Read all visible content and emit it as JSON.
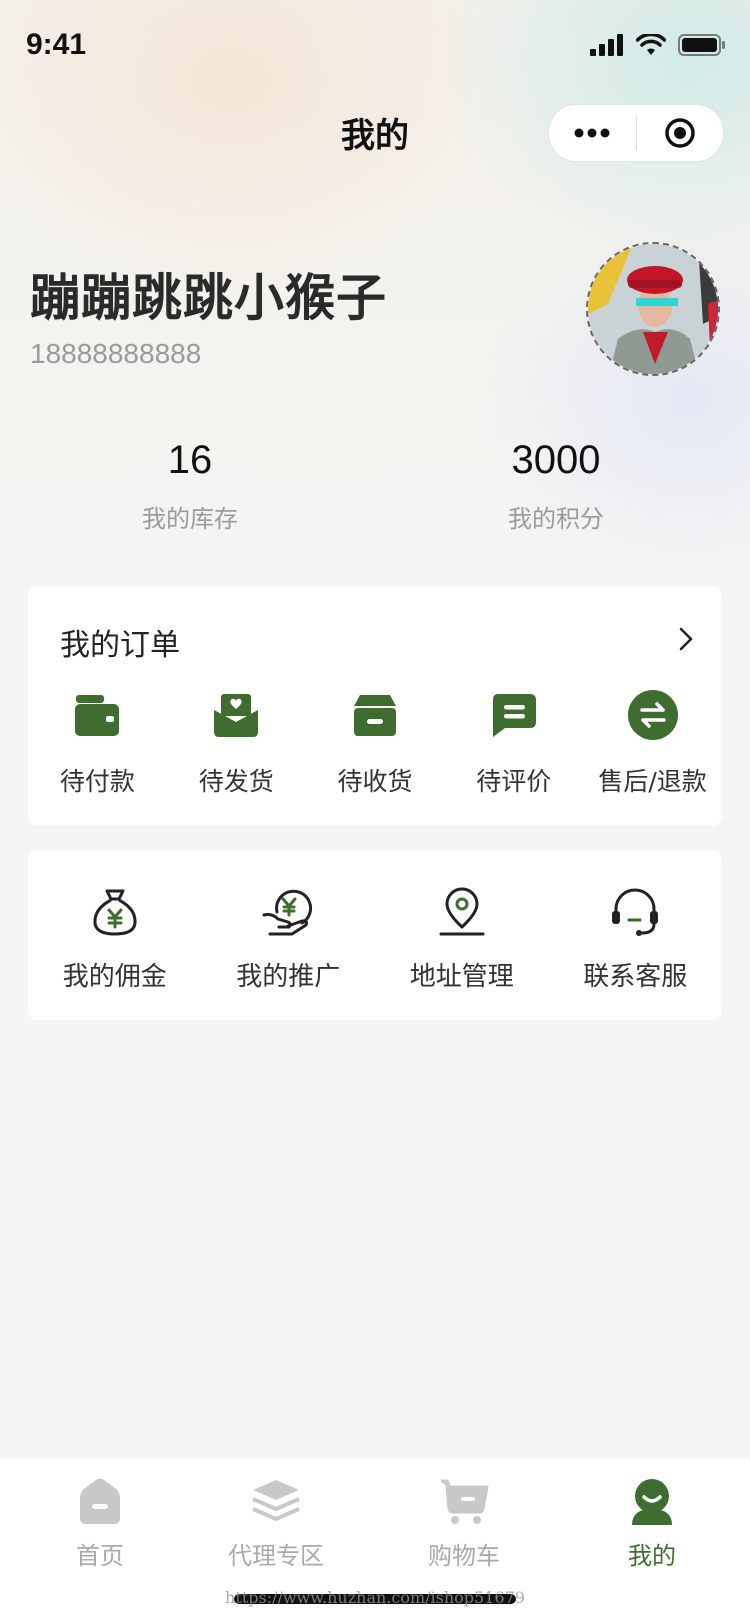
{
  "status": {
    "time": "9:41"
  },
  "nav": {
    "title": "我的"
  },
  "profile": {
    "name": "蹦蹦跳跳小猴子",
    "phone": "18888888888"
  },
  "stats": [
    {
      "value": "16",
      "label": "我的库存"
    },
    {
      "value": "3000",
      "label": "我的积分"
    }
  ],
  "orders": {
    "title": "我的订单",
    "items": [
      {
        "label": "待付款",
        "icon": "wallet-icon"
      },
      {
        "label": "待发货",
        "icon": "parcel-heart-icon"
      },
      {
        "label": "待收货",
        "icon": "box-icon"
      },
      {
        "label": "待评价",
        "icon": "chat-icon"
      },
      {
        "label": "售后/退款",
        "icon": "exchange-icon"
      }
    ]
  },
  "services": [
    {
      "label": "我的佣金",
      "icon": "money-bag-icon"
    },
    {
      "label": "我的推广",
      "icon": "hand-coin-icon"
    },
    {
      "label": "地址管理",
      "icon": "location-pin-icon"
    },
    {
      "label": "联系客服",
      "icon": "headset-icon"
    }
  ],
  "tabs": [
    {
      "label": "首页",
      "icon": "home-icon"
    },
    {
      "label": "代理专区",
      "icon": "layers-icon"
    },
    {
      "label": "购物车",
      "icon": "cart-icon"
    },
    {
      "label": "我的",
      "icon": "user-icon",
      "active": true
    }
  ],
  "watermark": "https://www.huzhan.com/ishop51679",
  "colors": {
    "accent": "#3f6d2f",
    "inactive": "#c8c8c8"
  }
}
